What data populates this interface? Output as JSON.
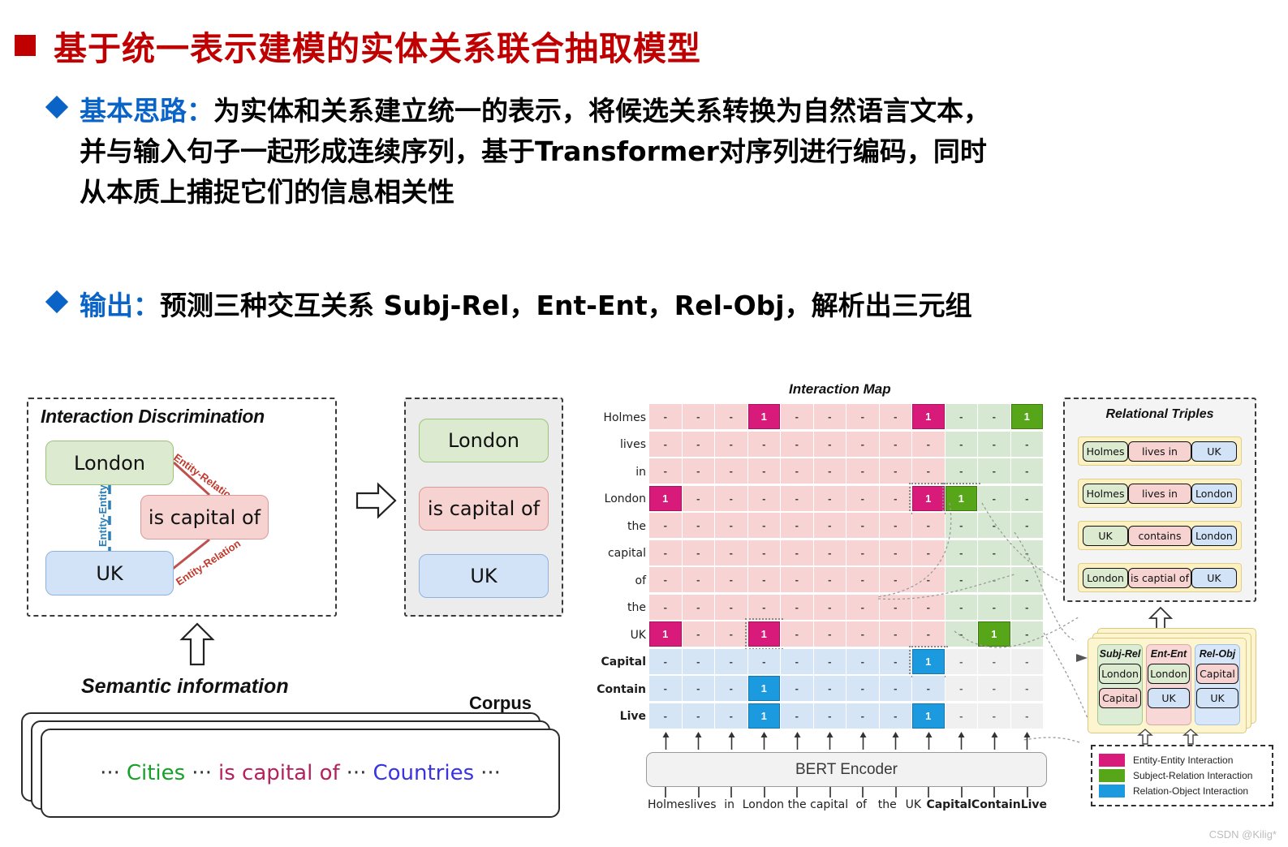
{
  "slide": {
    "title": "基于统一表示建模的实体关系联合抽取模型",
    "title_color": "#c00000",
    "accent_color": "#0a64c8",
    "bullets": [
      {
        "lead": "基本思路：",
        "lines": [
          "为实体和关系建立统一的表示，将候选关系转换为自然语言文本，",
          "并与输入句子一起形成连续序列，基于Transformer对序列进行编码，同时",
          "从本质上捕捉它们的信息相关性"
        ]
      },
      {
        "lead": "输出：",
        "lines": [
          "预测三种交互关系 Subj-Rel，Ent-Ent，Rel-Obj，解析出三元组"
        ]
      }
    ]
  },
  "left_figure": {
    "interaction_discrimination": {
      "title": "Interaction Discrimination",
      "nodes": [
        {
          "label": "London",
          "color": "#dcead0"
        },
        {
          "label": "is capital of",
          "color": "#f6d2d1"
        },
        {
          "label": "UK",
          "color": "#d3e3f7"
        }
      ],
      "edge_labels": {
        "entity_relation_top": "Entity-Relation",
        "entity_relation_bottom": "Entity-Relation",
        "entity_entity": "Entity-Entity"
      }
    },
    "output_panel": {
      "items": [
        {
          "label": "London",
          "color": "#dcead0"
        },
        {
          "label": "is capital of",
          "color": "#f6d2d1"
        },
        {
          "label": "UK",
          "color": "#d3e3f7"
        }
      ]
    },
    "semantic_information_label": "Semantic information",
    "corpus_label": "Corpus",
    "corpus_sentence": {
      "dots": "···",
      "cities": "Cities",
      "relation": "is capital of",
      "countries": "Countries",
      "cities_color": "#17a02a",
      "relation_color": "#b5215e",
      "countries_color": "#3a33e0"
    }
  },
  "chart_data": {
    "type": "heatmap",
    "title": "Interaction Map",
    "xlabel": "",
    "ylabel": "",
    "legend_position": "bottom-right",
    "columns": [
      "Holmes",
      "lives",
      "in",
      "London",
      "the",
      "capital",
      "of",
      "the",
      "UK",
      "Capital",
      "Contain",
      "Live"
    ],
    "rows": [
      "Holmes",
      "lives",
      "in",
      "London",
      "the",
      "capital",
      "of",
      "the",
      "UK",
      "Capital",
      "Contain",
      "Live"
    ],
    "row_bold_flags": [
      false,
      false,
      false,
      false,
      false,
      false,
      false,
      false,
      false,
      true,
      true,
      true
    ],
    "column_bold_flags": [
      false,
      false,
      false,
      false,
      false,
      false,
      false,
      false,
      false,
      true,
      true,
      true
    ],
    "empty_marker": "-",
    "filled_marker": "1",
    "values": [
      [
        0,
        0,
        0,
        1,
        0,
        0,
        0,
        0,
        1,
        0,
        0,
        1
      ],
      [
        0,
        0,
        0,
        0,
        0,
        0,
        0,
        0,
        0,
        0,
        0,
        0
      ],
      [
        0,
        0,
        0,
        0,
        0,
        0,
        0,
        0,
        0,
        0,
        0,
        0
      ],
      [
        1,
        0,
        0,
        0,
        0,
        0,
        0,
        0,
        1,
        1,
        0,
        0
      ],
      [
        0,
        0,
        0,
        0,
        0,
        0,
        0,
        0,
        0,
        0,
        0,
        0
      ],
      [
        0,
        0,
        0,
        0,
        0,
        0,
        0,
        0,
        0,
        0,
        0,
        0
      ],
      [
        0,
        0,
        0,
        0,
        0,
        0,
        0,
        0,
        0,
        0,
        0,
        0
      ],
      [
        0,
        0,
        0,
        0,
        0,
        0,
        0,
        0,
        0,
        0,
        0,
        0
      ],
      [
        1,
        0,
        0,
        1,
        0,
        0,
        0,
        0,
        0,
        0,
        1,
        0
      ],
      [
        0,
        0,
        0,
        0,
        0,
        0,
        0,
        0,
        1,
        0,
        0,
        0
      ],
      [
        0,
        0,
        0,
        1,
        0,
        0,
        0,
        0,
        0,
        0,
        0,
        0
      ],
      [
        0,
        0,
        0,
        1,
        0,
        0,
        0,
        0,
        1,
        0,
        0,
        0
      ]
    ],
    "highlighted_cells": [
      [
        3,
        8
      ],
      [
        3,
        9
      ],
      [
        8,
        3
      ],
      [
        9,
        8
      ]
    ],
    "cell_colors": {
      "entity_entity": "#d81b7b",
      "subject_relation": "#57a519",
      "relation_object": "#1b9ae0",
      "bg_token_token": "#f8d3d3",
      "bg_token_relation": "#d6e8d2",
      "bg_relation_token": "#d6e5f6",
      "bg_relation_relation": "#f0f0f0"
    }
  },
  "encoder": {
    "label": "BERT Encoder",
    "tokens": [
      "Holmes",
      "lives",
      "in",
      "London",
      "the",
      "capital",
      "of",
      "the",
      "UK",
      "Capital",
      "Contain",
      "Live"
    ],
    "token_bold_flags": [
      false,
      false,
      false,
      false,
      false,
      false,
      false,
      false,
      false,
      true,
      true,
      true
    ]
  },
  "relational_triples": {
    "title": "Relational Triples",
    "rows": [
      {
        "subject": "Holmes",
        "relation": "lives in",
        "object": "UK"
      },
      {
        "subject": "Holmes",
        "relation": "lives in",
        "object": "London"
      },
      {
        "subject": "UK",
        "relation": "contains",
        "object": "London"
      },
      {
        "subject": "London",
        "relation": "is captial of",
        "object": "UK"
      }
    ]
  },
  "interaction_stack": {
    "panels": [
      {
        "header": "Subj-Rel",
        "items": [
          "London",
          "Capital"
        ],
        "item_colors": [
          "green",
          "red"
        ],
        "panel_color": "green"
      },
      {
        "header": "Ent-Ent",
        "items": [
          "London",
          "UK"
        ],
        "item_colors": [
          "green",
          "blue"
        ],
        "panel_color": "red"
      },
      {
        "header": "Rel-Obj",
        "items": [
          "Capital",
          "UK"
        ],
        "item_colors": [
          "red",
          "blue"
        ],
        "panel_color": "blue"
      }
    ]
  },
  "legend": {
    "items": [
      {
        "label": "Entity-Entity Interaction",
        "color": "#d81b7b"
      },
      {
        "label": "Subject-Relation Interaction",
        "color": "#57a519"
      },
      {
        "label": "Relation-Object Interaction",
        "color": "#1b9ae0"
      }
    ]
  },
  "watermark": "CSDN @Kilig*"
}
